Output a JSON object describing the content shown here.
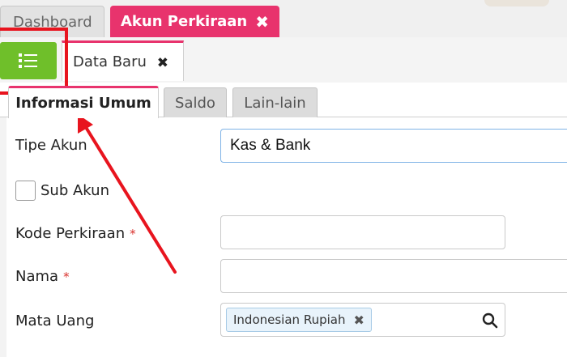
{
  "top_tabs": [
    {
      "label": "Dashboard"
    },
    {
      "label": "Akun Perkiraan",
      "close": "✖"
    }
  ],
  "toolbar": {
    "list_icon": "list-icon"
  },
  "sub_tab": {
    "label": "Data Baru",
    "close": "✖"
  },
  "form_tabs": [
    {
      "label": "Informasi Umum"
    },
    {
      "label": "Saldo"
    },
    {
      "label": "Lain-lain"
    }
  ],
  "form": {
    "tipe_akun": {
      "label": "Tipe Akun",
      "value": "Kas & Bank"
    },
    "sub_akun": {
      "label": "Sub Akun"
    },
    "kode_perkiraan": {
      "label": "Kode Perkiraan",
      "required": "*"
    },
    "nama": {
      "label": "Nama",
      "required": "*"
    },
    "mata_uang": {
      "label": "Mata Uang",
      "value": "Indonesian Rupiah",
      "remove": "✖"
    }
  },
  "colors": {
    "accent": "#e8336d",
    "button_green": "#6fbf2a",
    "annotation_red": "#e8141e"
  }
}
